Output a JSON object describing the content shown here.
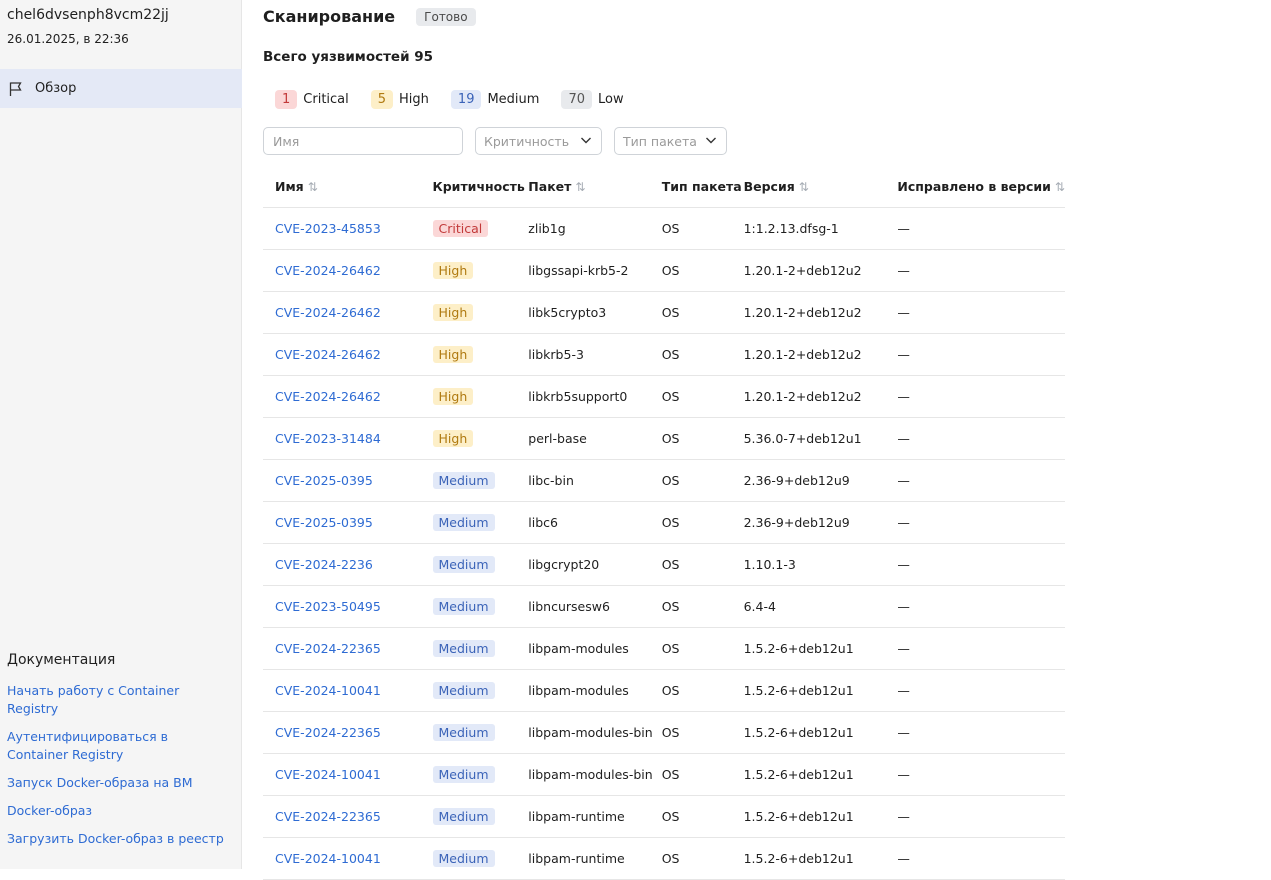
{
  "sidebar": {
    "title": "chel6dvsenph8vcm22jj",
    "date": "26.01.2025, в 22:36",
    "nav_label": "Обзор",
    "docs_heading": "Документация",
    "docs_links": [
      "Начать работу с Container Registry",
      "Аутентифицироваться в Container Registry",
      "Запуск Docker-образа на ВМ",
      "Docker-образ",
      "Загрузить Docker-образ в реестр"
    ]
  },
  "header": {
    "title": "Сканирование",
    "status": "Готово"
  },
  "summary": {
    "total_label": "Всего уязвимостей 95"
  },
  "chips": [
    {
      "count": "1",
      "label": "Critical",
      "bg": "#fbd7d7",
      "fg": "#c23a3a"
    },
    {
      "count": "5",
      "label": "High",
      "bg": "#fdefc8",
      "fg": "#b07a10"
    },
    {
      "count": "19",
      "label": "Medium",
      "bg": "#e2e9f8",
      "fg": "#3b63b8"
    },
    {
      "count": "70",
      "label": "Low",
      "bg": "#e8eaed",
      "fg": "#555555"
    }
  ],
  "filters": {
    "name_placeholder": "Имя",
    "severity_placeholder": "Критичность",
    "package_type_placeholder": "Тип пакета"
  },
  "table": {
    "headers": [
      "Имя",
      "Критичность",
      "Пакет",
      "Тип пакета",
      "Версия",
      "Исправлено в версии"
    ],
    "rows": [
      {
        "cve": "CVE-2023-45853",
        "severity": "Critical",
        "package": "zlib1g",
        "type": "OS",
        "version": "1:1.2.13.dfsg-1",
        "fixed": "—"
      },
      {
        "cve": "CVE-2024-26462",
        "severity": "High",
        "package": "libgssapi-krb5-2",
        "type": "OS",
        "version": "1.20.1-2+deb12u2",
        "fixed": "—"
      },
      {
        "cve": "CVE-2024-26462",
        "severity": "High",
        "package": "libk5crypto3",
        "type": "OS",
        "version": "1.20.1-2+deb12u2",
        "fixed": "—"
      },
      {
        "cve": "CVE-2024-26462",
        "severity": "High",
        "package": "libkrb5-3",
        "type": "OS",
        "version": "1.20.1-2+deb12u2",
        "fixed": "—"
      },
      {
        "cve": "CVE-2024-26462",
        "severity": "High",
        "package": "libkrb5support0",
        "type": "OS",
        "version": "1.20.1-2+deb12u2",
        "fixed": "—"
      },
      {
        "cve": "CVE-2023-31484",
        "severity": "High",
        "package": "perl-base",
        "type": "OS",
        "version": "5.36.0-7+deb12u1",
        "fixed": "—"
      },
      {
        "cve": "CVE-2025-0395",
        "severity": "Medium",
        "package": "libc-bin",
        "type": "OS",
        "version": "2.36-9+deb12u9",
        "fixed": "—"
      },
      {
        "cve": "CVE-2025-0395",
        "severity": "Medium",
        "package": "libc6",
        "type": "OS",
        "version": "2.36-9+deb12u9",
        "fixed": "—"
      },
      {
        "cve": "CVE-2024-2236",
        "severity": "Medium",
        "package": "libgcrypt20",
        "type": "OS",
        "version": "1.10.1-3",
        "fixed": "—"
      },
      {
        "cve": "CVE-2023-50495",
        "severity": "Medium",
        "package": "libncursesw6",
        "type": "OS",
        "version": "6.4-4",
        "fixed": "—"
      },
      {
        "cve": "CVE-2024-22365",
        "severity": "Medium",
        "package": "libpam-modules",
        "type": "OS",
        "version": "1.5.2-6+deb12u1",
        "fixed": "—"
      },
      {
        "cve": "CVE-2024-10041",
        "severity": "Medium",
        "package": "libpam-modules",
        "type": "OS",
        "version": "1.5.2-6+deb12u1",
        "fixed": "—"
      },
      {
        "cve": "CVE-2024-22365",
        "severity": "Medium",
        "package": "libpam-modules-bin",
        "type": "OS",
        "version": "1.5.2-6+deb12u1",
        "fixed": "—"
      },
      {
        "cve": "CVE-2024-10041",
        "severity": "Medium",
        "package": "libpam-modules-bin",
        "type": "OS",
        "version": "1.5.2-6+deb12u1",
        "fixed": "—"
      },
      {
        "cve": "CVE-2024-22365",
        "severity": "Medium",
        "package": "libpam-runtime",
        "type": "OS",
        "version": "1.5.2-6+deb12u1",
        "fixed": "—"
      },
      {
        "cve": "CVE-2024-10041",
        "severity": "Medium",
        "package": "libpam-runtime",
        "type": "OS",
        "version": "1.5.2-6+deb12u1",
        "fixed": "—"
      }
    ]
  },
  "severity_colors": {
    "Critical": {
      "bg": "#fbd7d7",
      "fg": "#c23a3a"
    },
    "High": {
      "bg": "#fdefc8",
      "fg": "#b07a10"
    },
    "Medium": {
      "bg": "#e2e9f8",
      "fg": "#3b63b8"
    },
    "Low": {
      "bg": "#e8eaed",
      "fg": "#555555"
    }
  },
  "icons": {
    "nav": "flag-icon",
    "sort": "sort-arrows-icon",
    "dropdown": "chevron-down-icon"
  }
}
